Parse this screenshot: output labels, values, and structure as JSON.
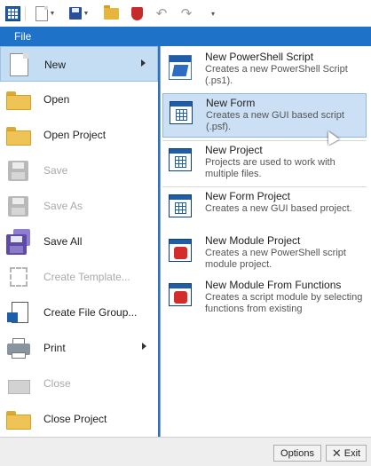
{
  "file_tab": {
    "label": "File"
  },
  "quick_access": {
    "app_icon": "app-grid-icon",
    "items": [
      "new-document-icon",
      "save-icon",
      "open-folder-icon",
      "shield-icon",
      "undo-icon",
      "redo-icon",
      "customize-dropdown-icon"
    ]
  },
  "left_menu": {
    "items": [
      {
        "label": "New",
        "icon": "new-document-icon",
        "state": "active",
        "submenu": true
      },
      {
        "label": "Open",
        "icon": "open-folder-icon",
        "state": "enabled"
      },
      {
        "label": "Open Project",
        "icon": "open-project-icon",
        "state": "enabled"
      },
      {
        "label": "Save",
        "icon": "save-icon",
        "state": "disabled"
      },
      {
        "label": "Save As",
        "icon": "save-as-icon",
        "state": "disabled"
      },
      {
        "label": "Save All",
        "icon": "save-all-icon",
        "state": "enabled"
      },
      {
        "label": "Create Template...",
        "icon": "template-icon",
        "state": "disabled"
      },
      {
        "label": "Create File Group...",
        "icon": "file-group-icon",
        "state": "enabled"
      },
      {
        "label": "Print",
        "icon": "printer-icon",
        "state": "enabled",
        "submenu": true
      },
      {
        "label": "Close",
        "icon": "close-folder-icon",
        "state": "disabled"
      },
      {
        "label": "Close Project",
        "icon": "close-project-icon",
        "state": "enabled"
      }
    ]
  },
  "new_submenu": {
    "items": [
      {
        "title": "New PowerShell Script",
        "description": "Creates a new PowerShell Script (.ps1).",
        "icon": "powershell-script-icon"
      },
      {
        "title": "New Form",
        "description": "Creates a new GUI based script (.psf).",
        "icon": "form-icon",
        "state": "hover"
      },
      {
        "title": "New Project",
        "description": "Projects are used to work with multiple files.",
        "icon": "project-icon"
      },
      {
        "title": "New Form Project",
        "description": "Creates a new GUI based project.",
        "icon": "form-project-icon"
      },
      {
        "title": "New Module Project",
        "description": "Creates a new PowerShell script module project.",
        "icon": "module-project-icon"
      },
      {
        "title": "New Module From Functions",
        "description": "Creates a script module by selecting functions from existing",
        "icon": "module-functions-icon"
      }
    ]
  },
  "footer": {
    "options_label": "Options",
    "exit_label": "Exit"
  },
  "colors": {
    "accent": "#1e72c7",
    "active_bg": "#c4ddf3",
    "hover_bg": "#cce0f5",
    "disabled_text": "#a9a9a9"
  }
}
